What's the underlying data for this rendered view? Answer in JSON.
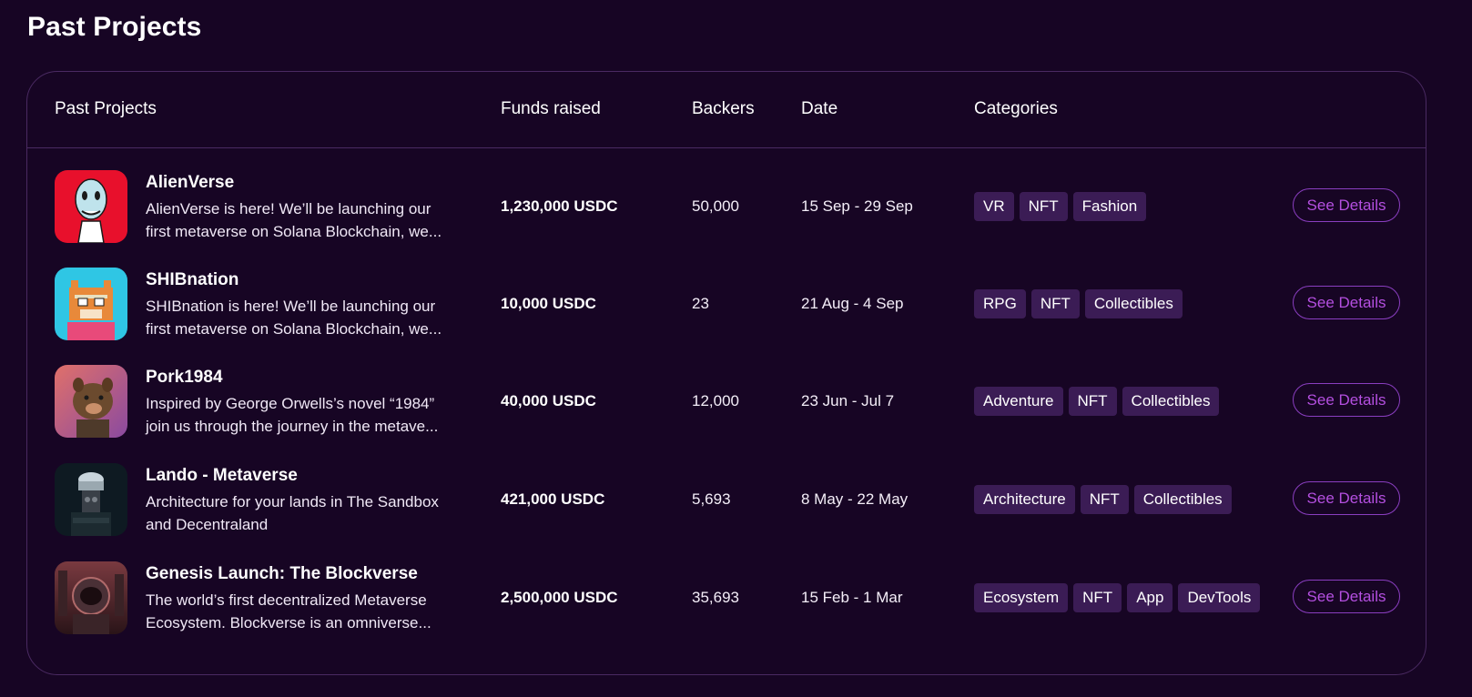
{
  "page": {
    "title": "Past Projects"
  },
  "table": {
    "headers": {
      "project": "Past Projects",
      "funds": "Funds raised",
      "backers": "Backers",
      "date": "Date",
      "categories": "Categories"
    },
    "rows": [
      {
        "name": "AlienVerse",
        "description": "AlienVerse is here! We’ll be launching our first metaverse on Solana Blockchain, we...",
        "funds": "1,230,000 USDC",
        "backers": "50,000",
        "date": "15 Sep - 29 Sep",
        "categories": [
          "VR",
          "NFT",
          "Fashion"
        ],
        "action": "See Details",
        "thumb_icon": "alien-avatar-icon",
        "thumb_color": "#e8102c"
      },
      {
        "name": "SHIBnation",
        "description": "SHIBnation is here! We’ll be launching our first metaverse on Solana Blockchain, we...",
        "funds": "10,000 USDC",
        "backers": "23",
        "date": "21 Aug - 4 Sep",
        "categories": [
          "RPG",
          "NFT",
          "Collectibles"
        ],
        "action": "See Details",
        "thumb_icon": "pixel-shiba-avatar-icon",
        "thumb_color": "#2fc6e4"
      },
      {
        "name": "Pork1984",
        "description": "Inspired by George Orwells’s novel “1984” join us through the journey in the metave...",
        "funds": "40,000 USDC",
        "backers": "12,000",
        "date": "23 Jun - Jul 7",
        "categories": [
          "Adventure",
          "NFT",
          "Collectibles"
        ],
        "action": "See Details",
        "thumb_icon": "boar-avatar-icon",
        "thumb_color": "#e07a6a"
      },
      {
        "name": "Lando - Metaverse",
        "description": "Architecture for your lands in The Sandbox and Decentraland",
        "funds": "421,000 USDC",
        "backers": "5,693",
        "date": "8 May - 22 May",
        "categories": [
          "Architecture",
          "NFT",
          "Collectibles"
        ],
        "action": "See Details",
        "thumb_icon": "metaverse-robot-avatar-icon",
        "thumb_color": "#0e1a22"
      },
      {
        "name": "Genesis Launch: The Blockverse",
        "description": "The world’s first decentralized Metaverse Ecosystem. Blockverse is an omniverse...",
        "funds": "2,500,000 USDC",
        "backers": "35,693",
        "date": "15 Feb - 1 Mar",
        "categories": [
          "Ecosystem",
          "NFT",
          "App",
          "DevTools"
        ],
        "action": "See Details",
        "thumb_icon": "helmet-astronaut-avatar-icon",
        "thumb_color": "#5a2a34"
      }
    ]
  }
}
